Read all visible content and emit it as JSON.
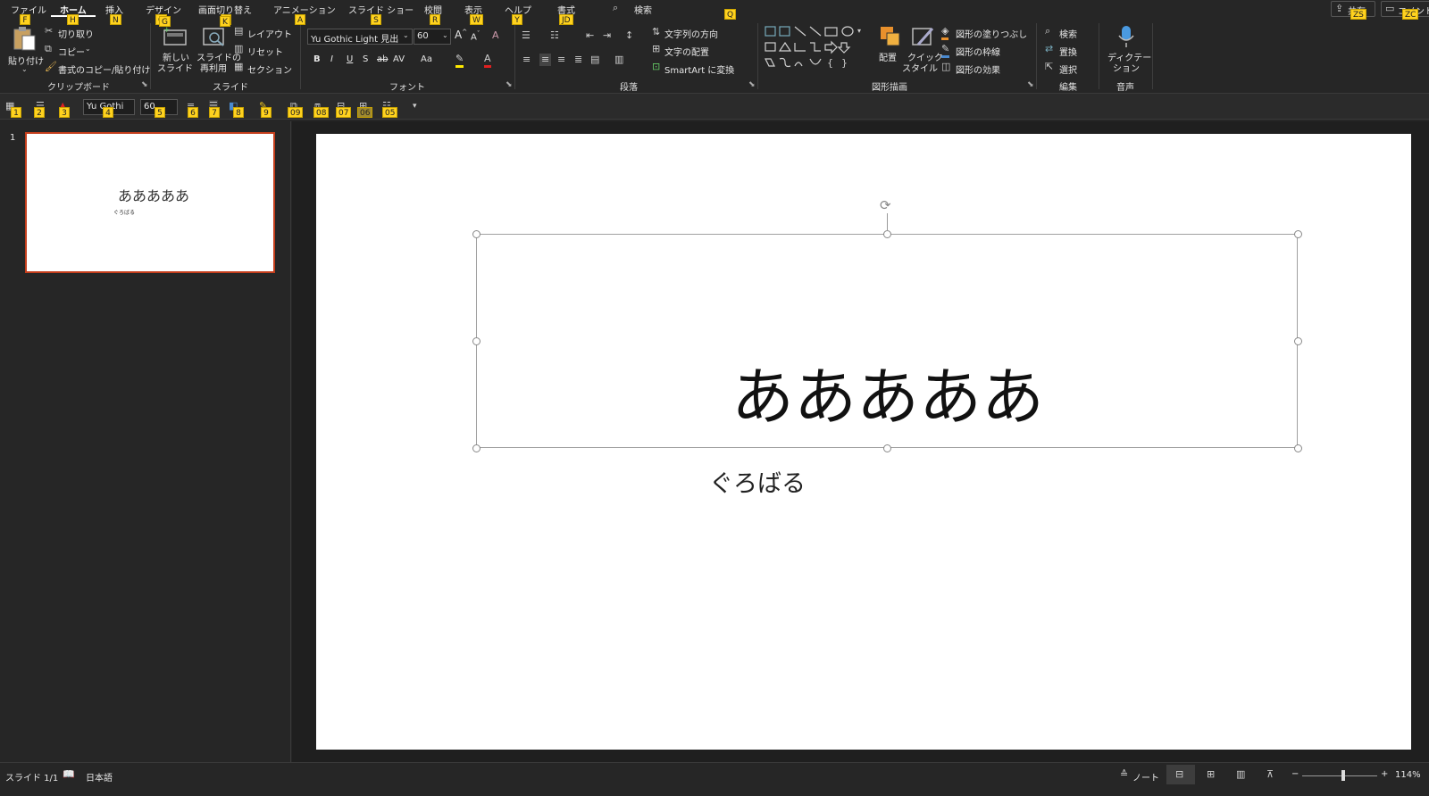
{
  "tabs": [
    {
      "label": "ファイル",
      "key": "F"
    },
    {
      "label": "ホーム",
      "key": "H"
    },
    {
      "label": "挿入",
      "key": "N"
    },
    {
      "label": "デザイン",
      "key": "G"
    },
    {
      "label": "画面切り替え",
      "key": "K"
    },
    {
      "label": "アニメーション",
      "key": "A"
    },
    {
      "label": "スライド ショー",
      "key": "S"
    },
    {
      "label": "校閲",
      "key": "R"
    },
    {
      "label": "表示",
      "key": "W"
    },
    {
      "label": "ヘルプ",
      "key": "Y"
    },
    {
      "label": "書式",
      "key": "JD"
    }
  ],
  "search": {
    "label": "検索",
    "key": "Q"
  },
  "top_right": {
    "share_label": "共有",
    "share_key": "ZS",
    "comment_label": "コメント",
    "comment_key": "ZC"
  },
  "clipboard": {
    "paste": "貼り付け",
    "cut": "切り取り",
    "copy": "コピー",
    "format_copy": "書式のコピー/貼り付け",
    "group": "クリップボード"
  },
  "slides": {
    "new_line1": "新しい",
    "new_line2": "スライド",
    "reuse_line1": "スライドの",
    "reuse_line2": "再利用",
    "layout": "レイアウト",
    "reset": "リセット",
    "section": "セクション",
    "group": "スライド"
  },
  "font": {
    "name": "Yu Gothic Light 見出し",
    "size": "60",
    "group": "フォント",
    "bold": "B",
    "italic": "I",
    "underline": "U",
    "shadow": "S",
    "strike": "ab",
    "spacing": "AV",
    "case": "Aa"
  },
  "paragraph": {
    "text_direction": "文字列の方向",
    "text_align": "文字の配置",
    "smartart": "SmartArt に変換",
    "group": "段落"
  },
  "drawing": {
    "arrange": "配置",
    "quick_line1": "クイック",
    "quick_line2": "スタイル",
    "fill": "図形の塗りつぶし",
    "outline": "図形の枠線",
    "effects": "図形の効果",
    "group": "図形描画"
  },
  "editing": {
    "find": "検索",
    "replace": "置換",
    "select": "選択",
    "group": "編集"
  },
  "voice": {
    "dictate_line1": "ディクテー",
    "dictate_line2": "ション",
    "group": "音声"
  },
  "qat": {
    "font_name": "Yu Gothi",
    "font_size": "60",
    "keys": [
      "1",
      "2",
      "3",
      "4",
      "5",
      "6",
      "7",
      "8",
      "9",
      "09",
      "08",
      "07",
      "06",
      "05"
    ]
  },
  "thumbnail": {
    "number": "1",
    "title": "あああああ",
    "subtitle": "ぐろばる"
  },
  "slide": {
    "title": "あああああ",
    "subtitle": "ぐろばる"
  },
  "status": {
    "slide_info": "スライド 1/1",
    "language": "日本語",
    "notes": "ノート",
    "zoom": "114%",
    "zoom_fraction": 0.55
  },
  "colors": {
    "accent": "#c43e1c",
    "keytip": "#ffd21f",
    "ribbon_bg": "#262626",
    "canvas_bg": "#1f1f1f"
  }
}
